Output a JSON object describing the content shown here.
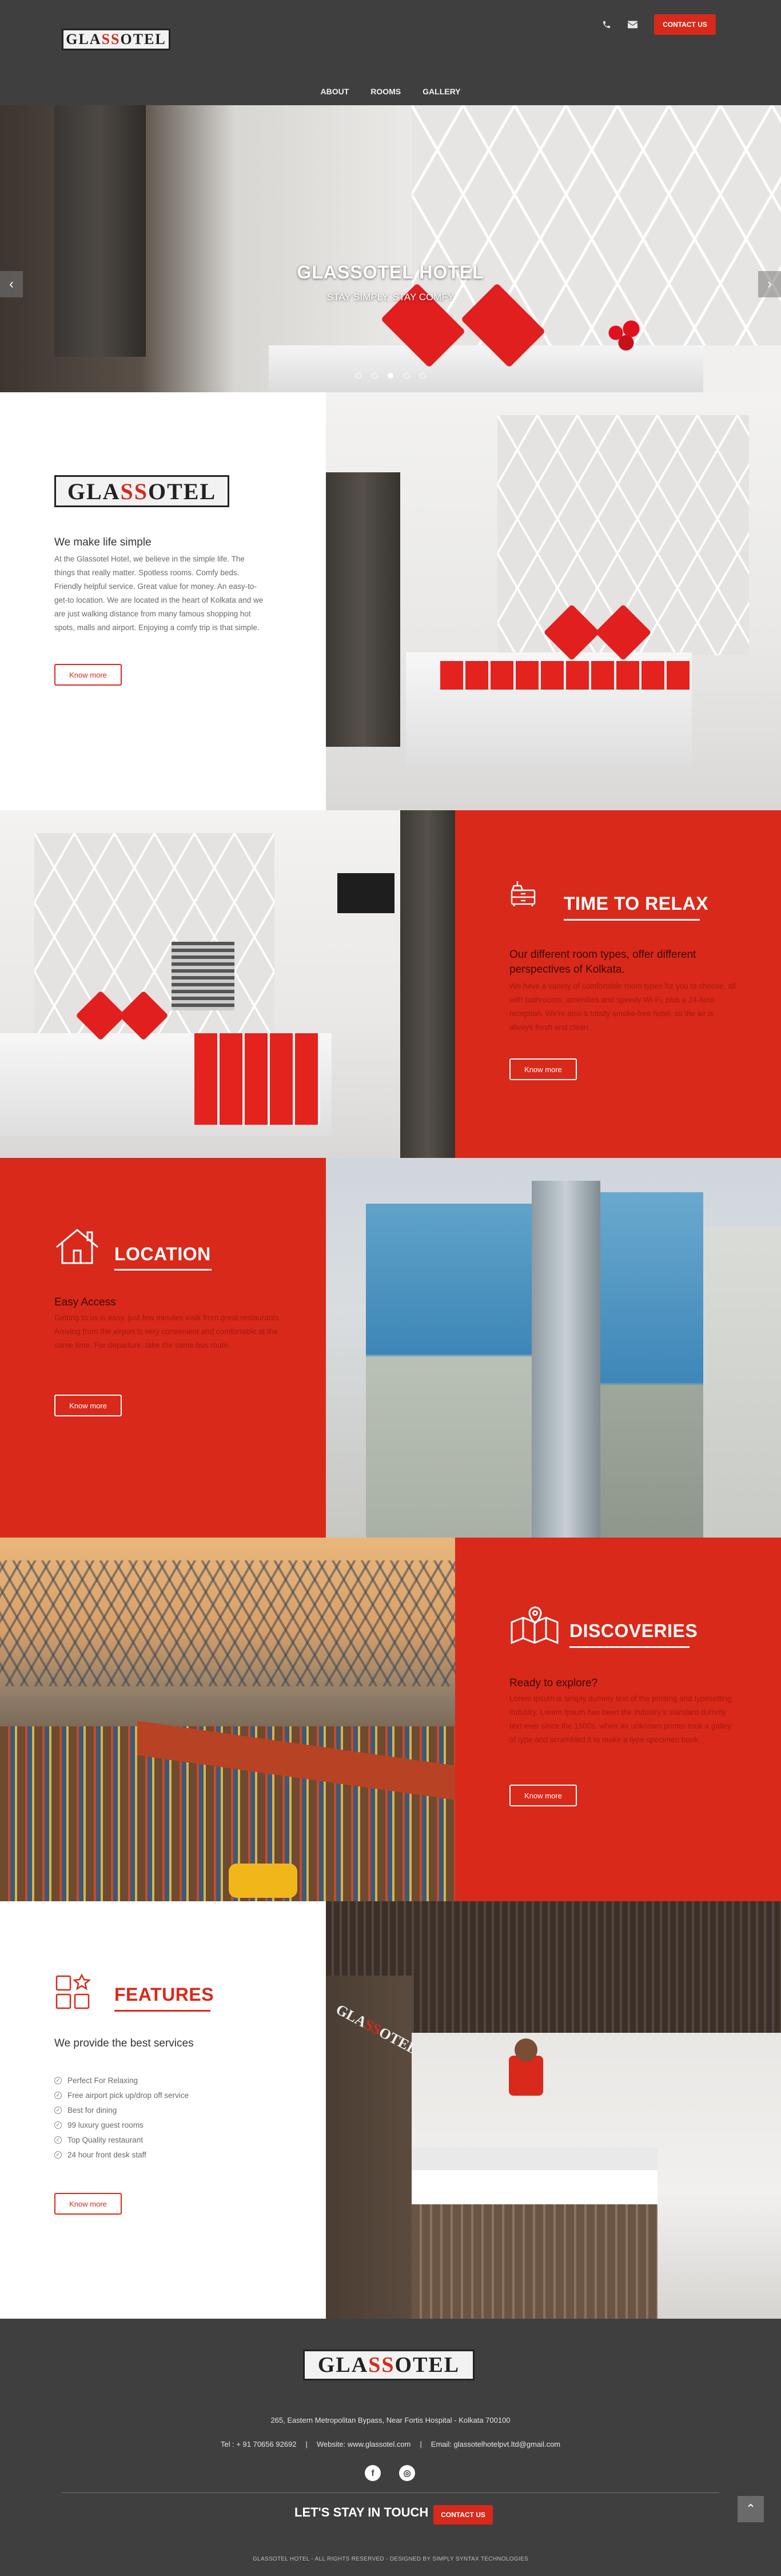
{
  "header": {
    "logo_text_1": "GLA",
    "logo_text_ss": "SS",
    "logo_text_2": "OTEL",
    "phone_icon": "phone-icon",
    "mail_icon": "mail-icon",
    "contact_label": "CONTACT US"
  },
  "nav": {
    "items": [
      {
        "label": "ABOUT"
      },
      {
        "label": "ROOMS"
      },
      {
        "label": "GALLERY"
      }
    ]
  },
  "hero": {
    "title": "GLASSOTEL HOTEL",
    "subtitle": "STAY SIMPLY, STAY COMFY",
    "prev_arrow": "‹",
    "next_arrow": "›",
    "slides": 5,
    "active_slide": 3
  },
  "about": {
    "heading": "We make life simple",
    "body": "At the Glassotel Hotel, we believe in the simple life. The things that really matter. Spotless rooms. Comfy beds. Friendly helpful service. Great value for money. An easy-to-get-to location. We are located in the heart of Kolkata and we are just walking distance from many famous shopping hot spots, malls and airport. Enjoying a comfy trip is that simple.",
    "button": "Know more"
  },
  "relax": {
    "title": "TIME TO RELAX",
    "subheading": "Our different room types, offer different perspectives of Kolkata.",
    "body": "We have a variety of comfortable room types for you to choose, all with bathrooms, amenities and speedy Wi-Fi, plus a 24-hour reception. We're also a totally smoke-free hotel, so the air is always fresh and clean.",
    "button": "Know more"
  },
  "location": {
    "title": "LOCATION",
    "subheading": "Easy Access",
    "body": "Getting to us is easy, just few minutes walk from great restaurants. Arriving from the airport is very convenient and comfortable at the same time. For departure, take the same bus route.",
    "button": "Know more"
  },
  "discoveries": {
    "title": "DISCOVERIES",
    "subheading": "Ready to explore?",
    "body": "Lorem Ipsum is simply dummy text of the printing and typesetting industry. Lorem Ipsum has been the industry's standard dummy text ever since the 1500s, when an unknown printer took a galley of type and scrambled it to make a type specimen book.",
    "button": "Know more"
  },
  "features": {
    "title": "FEATURES",
    "subheading": "We provide the best services",
    "items": [
      "Perfect For Relaxing",
      "Free airport pick up/drop off service",
      "Best for dining",
      "99 luxury guest rooms",
      "Top Quality restaurant",
      "24 hour front desk staff"
    ],
    "button": "Know more"
  },
  "footer": {
    "address": "265, Eastern Metropolitan Bypass, Near Fortis Hospital - Kolkata 700100",
    "tel": "Tel : + 91 70656 92692",
    "website": "Website: www.glassotel.com",
    "email": "Email: glassotelhotelpvt.ltd@gmail.com",
    "sep": "|",
    "facebook": "f",
    "instagram": "◎",
    "stay_label": "LET'S STAY IN TOUCH",
    "contact_label": "CONTACT US",
    "copyright": "GLASSOTEL HOTEL - ALL RIGHTS RESERVED - DESIGNED BY SIMPLY SYNTAX TECHNOLOGIES",
    "totop": "⌃"
  },
  "colors": {
    "brand_red": "#d9291a",
    "header_gray": "#3f3f3f"
  }
}
